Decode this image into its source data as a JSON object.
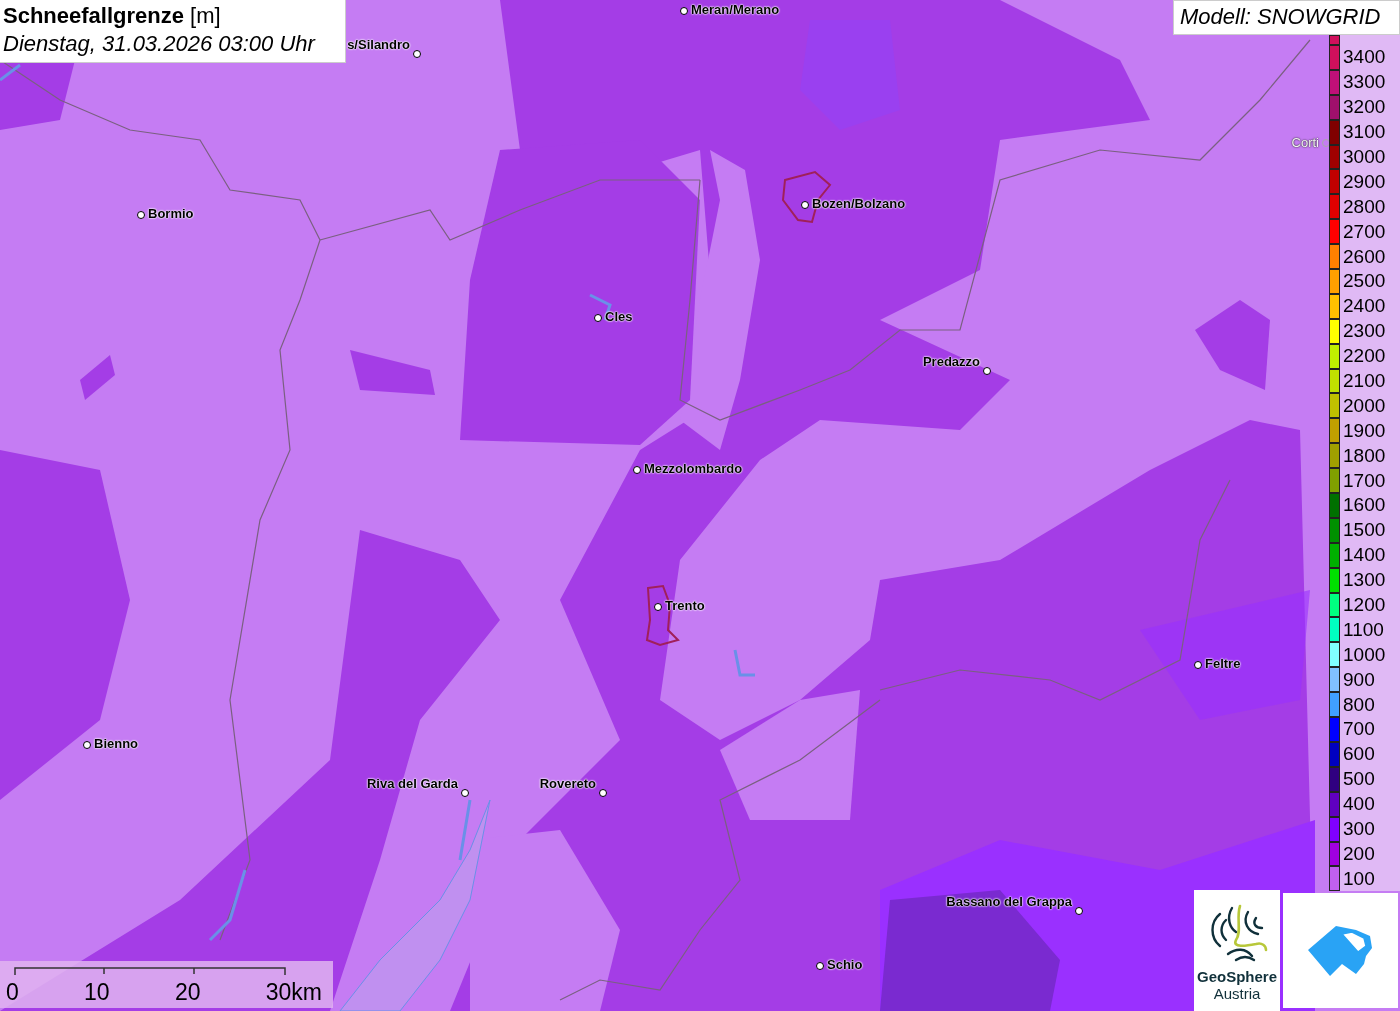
{
  "title": {
    "heading": "**Schneefallgrenze** [m]",
    "time": "Dienstag, 31.03.2026 03:00 Uhr"
  },
  "model": "Modell: SNOWGRID",
  "cities": [
    {
      "name": "s/Silandro",
      "dimmed": false
    },
    {
      "name": "Meran/Merano",
      "dimmed": false
    },
    {
      "name": "Bormio",
      "dimmed": false
    },
    {
      "name": "Bozen/Bolzano",
      "dimmed": false
    },
    {
      "name": "Corti",
      "dimmed": true
    },
    {
      "name": "Cles",
      "dimmed": false
    },
    {
      "name": "Predazzo",
      "dimmed": false
    },
    {
      "name": "Mezzolombardo",
      "dimmed": false
    },
    {
      "name": "Trento",
      "dimmed": false
    },
    {
      "name": "Feltre",
      "dimmed": false
    },
    {
      "name": "Bienno",
      "dimmed": false
    },
    {
      "name": "Riva del Garda",
      "dimmed": false
    },
    {
      "name": "Rovereto",
      "dimmed": false
    },
    {
      "name": "Bassano del Grappa",
      "dimmed": false
    },
    {
      "name": "Schio",
      "dimmed": false
    }
  ],
  "legend": [
    {
      "label": "3400",
      "color": "#d0105c"
    },
    {
      "label": "3300",
      "color": "#c01078"
    },
    {
      "label": "3200",
      "color": "#a0106c"
    },
    {
      "label": "3100",
      "color": "#800000"
    },
    {
      "label": "3000",
      "color": "#a00000"
    },
    {
      "label": "2900",
      "color": "#c00000"
    },
    {
      "label": "2800",
      "color": "#e00000"
    },
    {
      "label": "2700",
      "color": "#ff0000"
    },
    {
      "label": "2600",
      "color": "#ff8000"
    },
    {
      "label": "2500",
      "color": "#ffa000"
    },
    {
      "label": "2400",
      "color": "#ffc000"
    },
    {
      "label": "2300",
      "color": "#ffff00"
    },
    {
      "label": "2200",
      "color": "#c0f000"
    },
    {
      "label": "2100",
      "color": "#c0e000"
    },
    {
      "label": "2000",
      "color": "#c0c000"
    },
    {
      "label": "1900",
      "color": "#c0a000"
    },
    {
      "label": "1800",
      "color": "#a0a000"
    },
    {
      "label": "1700",
      "color": "#80a000"
    },
    {
      "label": "1600",
      "color": "#007000"
    },
    {
      "label": "1500",
      "color": "#009000"
    },
    {
      "label": "1400",
      "color": "#00b000"
    },
    {
      "label": "1300",
      "color": "#00e000"
    },
    {
      "label": "1200",
      "color": "#00ff80"
    },
    {
      "label": "1100",
      "color": "#00ffc0"
    },
    {
      "label": "1000",
      "color": "#80ffff"
    },
    {
      "label": "900",
      "color": "#80c0ff"
    },
    {
      "label": "800",
      "color": "#40a0ff"
    },
    {
      "label": "700",
      "color": "#0000ff"
    },
    {
      "label": "600",
      "color": "#0000c0"
    },
    {
      "label": "500",
      "color": "#300080"
    },
    {
      "label": "400",
      "color": "#6000c0"
    },
    {
      "label": "300",
      "color": "#8000ff"
    },
    {
      "label": "200",
      "color": "#a000e0"
    },
    {
      "label": "100",
      "color": "#c060f0"
    }
  ],
  "scale_bar": {
    "labels": [
      "0",
      "10",
      "20",
      "30km"
    ]
  },
  "logo": {
    "name": "GeoSphere",
    "subtitle": "Austria"
  }
}
